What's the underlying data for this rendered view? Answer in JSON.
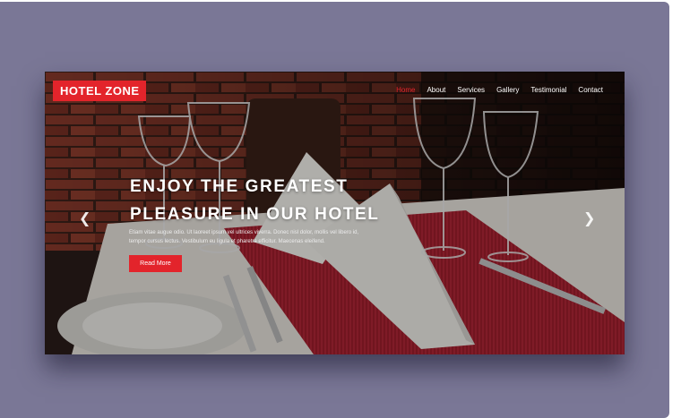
{
  "header": {
    "logo": "HOTEL ZONE",
    "nav": [
      "Home",
      "About",
      "Services",
      "Gallery",
      "Testimonial",
      "Contact"
    ],
    "active_nav": "Home"
  },
  "hero": {
    "headline_line1": "ENJOY THE GREATEST",
    "headline_line2": "PLEASURE IN OUR HOTEL",
    "description_line1": "Etiam vitae augue odio. Ut laoreet ipsum vel ultrices viverra. Donec nisl dolor, mollis vel libero id,",
    "description_line2": "tempor cursus lectus. Vestibulum eu ligula et pharetra efficitur. Maecenas eleifend.",
    "button_label": "Read More"
  },
  "carousel": {
    "prev_icon": "chevron-left-icon",
    "next_icon": "chevron-right-icon"
  },
  "colors": {
    "accent": "#e3242b",
    "backdrop": "#7a7796"
  }
}
